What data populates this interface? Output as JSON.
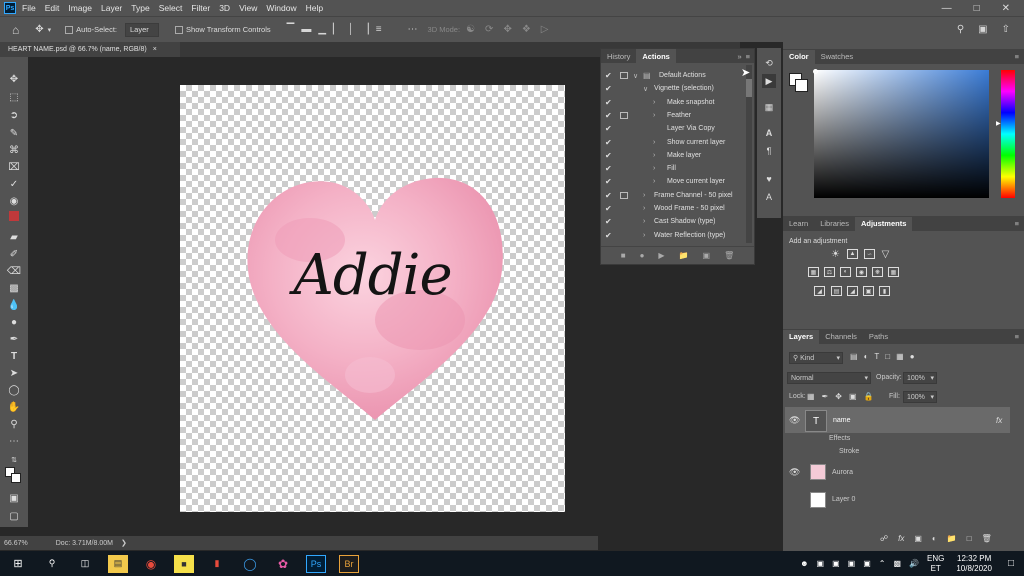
{
  "menubar": {
    "app_icon": "Ps",
    "items": [
      "File",
      "Edit",
      "Image",
      "Layer",
      "Type",
      "Select",
      "Filter",
      "3D",
      "View",
      "Window",
      "Help"
    ],
    "window_controls": [
      "minimize-icon",
      "maximize-icon",
      "close-icon"
    ]
  },
  "options_bar": {
    "auto_select_label": "Auto-Select:",
    "auto_select_value": "Layer",
    "show_transform_label": "Show Transform Controls",
    "mode_3d_label": "3D Mode:"
  },
  "document": {
    "tab_title": "HEART NAME.psd @ 66.7% (name, RGB/8)",
    "canvas_text": "Addie",
    "zoom": "66.67%",
    "doc_size": "Doc: 3.71M/8.00M"
  },
  "actions_panel": {
    "tabs": [
      "History",
      "Actions"
    ],
    "active_tab": "Actions",
    "rows": [
      {
        "label": "Default Actions",
        "indent": 0,
        "type": "set"
      },
      {
        "label": "Vignette (selection)",
        "indent": 1,
        "type": "action"
      },
      {
        "label": "Make snapshot",
        "indent": 2,
        "type": "step"
      },
      {
        "label": "Feather",
        "indent": 2,
        "type": "step"
      },
      {
        "label": "Layer Via Copy",
        "indent": 2,
        "type": "step"
      },
      {
        "label": "Show current layer",
        "indent": 2,
        "type": "step"
      },
      {
        "label": "Make layer",
        "indent": 2,
        "type": "step"
      },
      {
        "label": "Fill",
        "indent": 2,
        "type": "step"
      },
      {
        "label": "Move current layer",
        "indent": 2,
        "type": "step"
      },
      {
        "label": "Frame Channel - 50 pixel",
        "indent": 1,
        "type": "action"
      },
      {
        "label": "Wood Frame - 50 pixel",
        "indent": 1,
        "type": "action"
      },
      {
        "label": "Cast Shadow (type)",
        "indent": 1,
        "type": "action"
      },
      {
        "label": "Water Reflection (type)",
        "indent": 1,
        "type": "action"
      }
    ]
  },
  "color_panel": {
    "tabs": [
      "Color",
      "Swatches"
    ],
    "active_tab": "Color"
  },
  "adjustments_panel": {
    "tabs": [
      "Learn",
      "Libraries",
      "Adjustments"
    ],
    "active_tab": "Adjustments",
    "add_label": "Add an adjustment"
  },
  "layers_panel": {
    "tabs": [
      "Layers",
      "Channels",
      "Paths"
    ],
    "active_tab": "Layers",
    "filter_kind": "Kind",
    "blend_mode": "Normal",
    "opacity_label": "Opacity:",
    "opacity": "100%",
    "lock_label": "Lock:",
    "fill_label": "Fill:",
    "fill": "100%",
    "layers": [
      {
        "name": "name",
        "kind": "text",
        "effects_label": "Effects",
        "effect": "Stroke",
        "fx": "fx"
      },
      {
        "name": "Aurora",
        "kind": "image"
      },
      {
        "name": "Layer 0",
        "kind": "image"
      }
    ]
  },
  "taskbar": {
    "language": "ENG",
    "language_region": "ET",
    "time": "12:32 PM",
    "date": "10/8/2020",
    "apps": [
      "Ps",
      "Br"
    ]
  },
  "colors": {
    "accent": "#31a8ff",
    "panel": "#535353",
    "canvas_bg": "#282828",
    "heart": "#f2a7c0"
  }
}
